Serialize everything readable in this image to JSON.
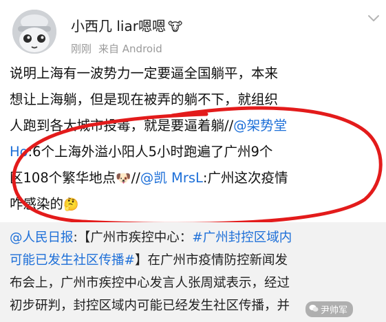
{
  "post": {
    "username": "小西几 liar嗯嗯",
    "username_emoji": "🐮",
    "time": "刚刚",
    "source": "来自 Android",
    "lines": [
      {
        "text": "说明上海有一波势力一定要逼全国躺平，本来"
      },
      {
        "text": "想让上海躺，但是现在被弄的躺不下，就组织"
      },
      {
        "text": "人跑到各大城市投毒，就是要逼着躺//",
        "mention": "@架势堂"
      },
      {
        "mention": "Ho",
        "text": ":6个上海外溢小阳人5小时跑遍了广州9个"
      },
      {
        "text": "区108个繁华地点",
        "emoji": "🐶",
        "text2": "//",
        "mention": "@凯 MrsL",
        "text3": ":广州这次疫情"
      },
      {
        "text": "咋感染的",
        "emoji": "🤔"
      }
    ]
  },
  "repost": {
    "lines": [
      {
        "author": "@人民日报",
        "text": ":【广州市疾控中心：",
        "tag": "#广州封控区域内"
      },
      {
        "tag": "可能已发生社区传播#",
        "text": "】在广州市疫情防控新闻发"
      },
      {
        "text": "布会上，广州市疾控中心发言人张周斌表示，经过"
      },
      {
        "text": "初步研判，封控区域内可能已经发生社区传播，并"
      }
    ]
  },
  "watermark": {
    "text": "尹帅军"
  },
  "colors": {
    "link": "#1d6fd8",
    "highlight_circle": "#e31b1b",
    "repost_bg": "#f2f2f2"
  }
}
